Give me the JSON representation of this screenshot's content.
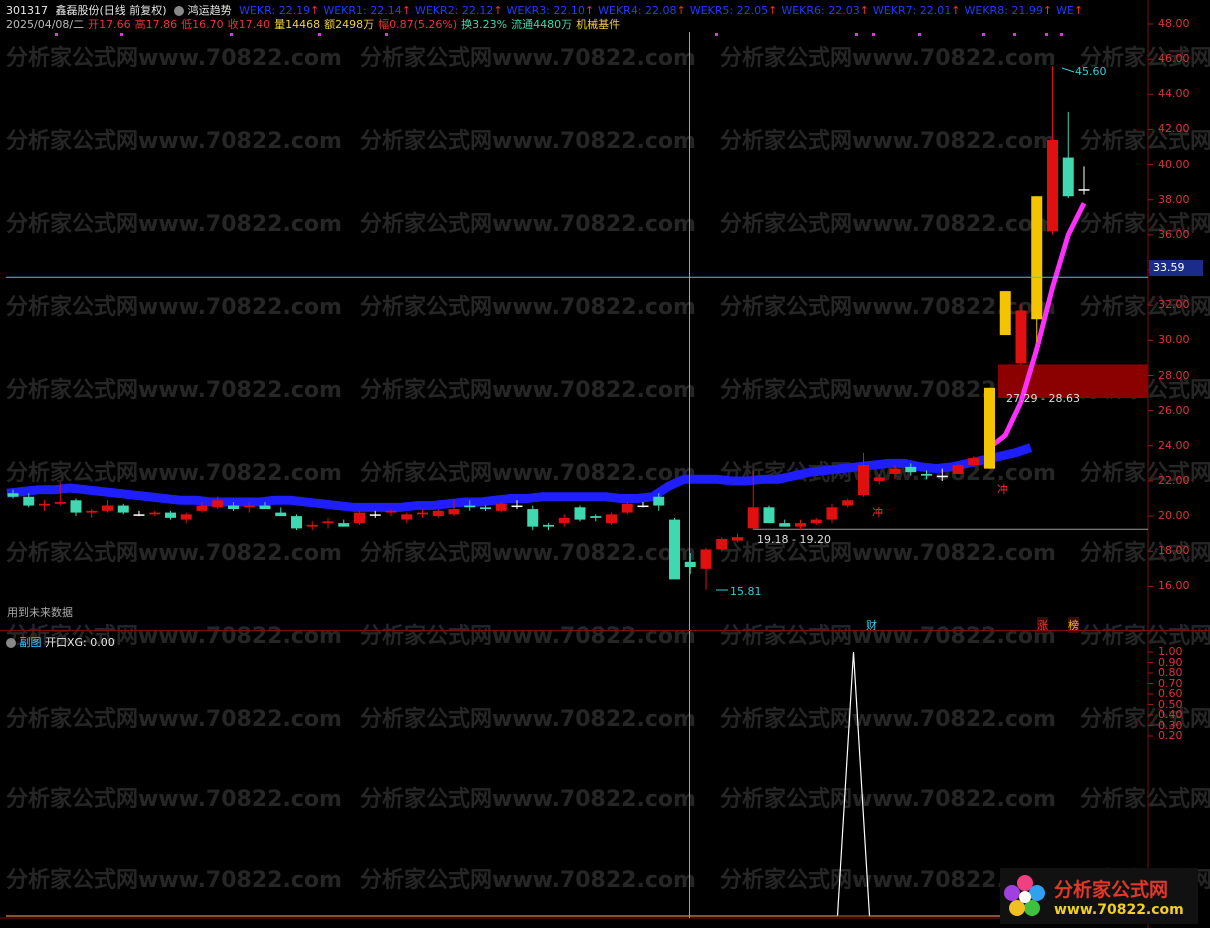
{
  "header": {
    "code": "301317",
    "name": "鑫磊股份(日线 前复权)",
    "indicator_name": "鸿运趋势",
    "wekr": [
      {
        "label": "WEKR: 22.19",
        "color": "#1e3cff"
      },
      {
        "label": "WEKR1: 22.14",
        "color": "#1e3cff"
      },
      {
        "label": "WEKR2: 22.12",
        "color": "#1e3cff"
      },
      {
        "label": "WEKR3: 22.10",
        "color": "#1e3cff"
      },
      {
        "label": "WEKR4: 22.08",
        "color": "#1e3cff"
      },
      {
        "label": "WEKR5: 22.05",
        "color": "#1e3cff"
      },
      {
        "label": "WEKR6: 22.03",
        "color": "#1e3cff"
      },
      {
        "label": "WEKR7: 22.01",
        "color": "#1e3cff"
      },
      {
        "label": "WEKR8: 21.99",
        "color": "#1e3cff"
      },
      {
        "label": "WE",
        "color": "#1e3cff"
      }
    ],
    "date": "2025/04/08/二",
    "open": "开17.66",
    "high": "高17.86",
    "low": "低16.70",
    "close": "收17.40",
    "volume": "量14468",
    "amount": "额2498万",
    "change": "幅0.87(5.26%)",
    "turnover": "换3.23%",
    "float": "流通4480万",
    "industry": "机械基件"
  },
  "main_chart": {
    "y_ticks": [
      "48.00",
      "46.00",
      "44.00",
      "42.00",
      "40.00",
      "38.00",
      "36.00",
      "34.00",
      "32.00",
      "30.00",
      "28.00",
      "26.00",
      "24.00",
      "22.00",
      "20.00",
      "18.00",
      "16.00"
    ],
    "y_values": [
      48,
      46,
      44,
      42,
      40,
      38,
      36,
      34,
      32,
      30,
      28,
      26,
      24,
      22,
      20,
      18,
      16
    ],
    "current_price": "33.59",
    "annotations": {
      "high_label": "45.60",
      "low_label": "15.81",
      "range1": "19.18 - 19.20",
      "range2": "27.29 - 28.63",
      "chong1": "冲",
      "chong2": "冲",
      "future_note": "用到未来数据",
      "tag_cai": "财",
      "tag_zhang": "涨",
      "tag_bang": "榜"
    },
    "colors": {
      "up": "#e01010",
      "down": "#40d8b0",
      "gold": "#f5c400",
      "trend_blue": "#1e1eff",
      "trend_magenta": "#ff30ff",
      "crosshair": "#40c8d8",
      "red_zone": "#8b0000"
    },
    "candles": [
      [
        21.3,
        21.5,
        21.0,
        21.1
      ],
      [
        21.1,
        21.3,
        20.5,
        20.6
      ],
      [
        20.6,
        20.9,
        20.3,
        20.7
      ],
      [
        20.7,
        21.9,
        20.6,
        20.8
      ],
      [
        20.9,
        21.0,
        20.0,
        20.2
      ],
      [
        20.2,
        20.4,
        19.9,
        20.3
      ],
      [
        20.3,
        20.9,
        20.2,
        20.6
      ],
      [
        20.6,
        20.7,
        20.1,
        20.2
      ],
      [
        20.1,
        20.3,
        20.0,
        20.1
      ],
      [
        20.1,
        20.3,
        20.0,
        20.2
      ],
      [
        20.2,
        20.3,
        19.8,
        19.9
      ],
      [
        19.8,
        20.2,
        19.6,
        20.1
      ],
      [
        20.3,
        20.8,
        20.2,
        20.6
      ],
      [
        20.5,
        21.1,
        20.4,
        20.9
      ],
      [
        20.6,
        20.8,
        20.3,
        20.4
      ],
      [
        20.5,
        20.8,
        20.2,
        20.6
      ],
      [
        20.6,
        20.8,
        20.4,
        20.4
      ],
      [
        20.2,
        20.5,
        20.0,
        20.0
      ],
      [
        20.0,
        20.1,
        19.2,
        19.3
      ],
      [
        19.4,
        19.7,
        19.2,
        19.5
      ],
      [
        19.6,
        19.9,
        19.3,
        19.7
      ],
      [
        19.6,
        19.8,
        19.4,
        19.4
      ],
      [
        19.6,
        20.3,
        19.5,
        20.2
      ],
      [
        20.1,
        20.3,
        19.9,
        20.1
      ],
      [
        20.2,
        20.4,
        20.0,
        20.3
      ],
      [
        19.8,
        20.2,
        19.6,
        20.1
      ],
      [
        20.1,
        20.4,
        19.9,
        20.2
      ],
      [
        20.0,
        20.4,
        19.9,
        20.3
      ],
      [
        20.1,
        20.9,
        20.0,
        20.4
      ],
      [
        20.6,
        20.9,
        20.3,
        20.5
      ],
      [
        20.5,
        20.6,
        20.3,
        20.4
      ],
      [
        20.3,
        20.8,
        20.2,
        20.7
      ],
      [
        20.6,
        20.9,
        20.4,
        20.6
      ],
      [
        20.4,
        20.6,
        19.2,
        19.4
      ],
      [
        19.5,
        19.6,
        19.2,
        19.4
      ],
      [
        19.6,
        20.1,
        19.4,
        19.9
      ],
      [
        20.5,
        20.6,
        19.7,
        19.8
      ],
      [
        20.0,
        20.1,
        19.7,
        19.9
      ],
      [
        19.6,
        20.2,
        19.5,
        20.1
      ],
      [
        20.2,
        20.8,
        20.1,
        20.7
      ],
      [
        20.6,
        20.8,
        20.5,
        20.6
      ],
      [
        21.1,
        21.3,
        20.3,
        20.6
      ],
      [
        19.8,
        19.9,
        16.4,
        16.4
      ],
      [
        17.4,
        17.9,
        16.7,
        17.1
      ],
      [
        17.0,
        18.2,
        15.8,
        18.1
      ],
      [
        18.1,
        18.8,
        18.0,
        18.7
      ],
      [
        18.6,
        19.0,
        18.5,
        18.8
      ],
      [
        19.3,
        22.6,
        19.2,
        20.5
      ],
      [
        20.5,
        20.6,
        19.6,
        19.6
      ],
      [
        19.6,
        19.8,
        19.4,
        19.4
      ],
      [
        19.4,
        19.8,
        19.2,
        19.6
      ],
      [
        19.6,
        19.9,
        19.5,
        19.8
      ],
      [
        19.8,
        20.7,
        19.6,
        20.5
      ],
      [
        20.6,
        21.0,
        20.5,
        20.9
      ],
      [
        21.2,
        23.6,
        21.1,
        22.9
      ],
      [
        22.0,
        22.4,
        21.8,
        22.2
      ],
      [
        22.4,
        22.9,
        22.1,
        22.7
      ],
      [
        22.8,
        23.0,
        22.3,
        22.5
      ],
      [
        22.4,
        22.6,
        22.1,
        22.3
      ],
      [
        22.3,
        22.7,
        22.0,
        22.3
      ],
      [
        22.4,
        23.0,
        22.4,
        22.9
      ],
      [
        22.9,
        23.4,
        22.8,
        23.3
      ],
      [
        22.7,
        27.3,
        22.7,
        27.3
      ],
      [
        30.3,
        32.8,
        30.3,
        32.8
      ],
      [
        28.7,
        32.1,
        28.6,
        31.7
      ],
      [
        31.2,
        38.2,
        29.9,
        38.2
      ],
      [
        36.2,
        45.6,
        36.0,
        41.4
      ],
      [
        40.4,
        43.0,
        38.1,
        38.2
      ],
      [
        38.6,
        39.9,
        38.3,
        38.6
      ]
    ],
    "gold_indices": [
      62,
      63,
      65
    ],
    "trend_blue": [
      21.3,
      21.4,
      21.5,
      21.5,
      21.6,
      21.5,
      21.4,
      21.3,
      21.2,
      21.1,
      21.0,
      20.9,
      20.9,
      20.8,
      20.8,
      20.8,
      20.8,
      20.9,
      20.9,
      20.8,
      20.7,
      20.6,
      20.5,
      20.5,
      20.5,
      20.5,
      20.6,
      20.6,
      20.7,
      20.8,
      20.8,
      20.9,
      21.0,
      21.0,
      21.1,
      21.1,
      21.1,
      21.1,
      21.1,
      21.0,
      21.0,
      21.1,
      21.7,
      22.1,
      22.1,
      22.1,
      22.0,
      22.0,
      22.1,
      22.1,
      22.3,
      22.5,
      22.6,
      22.7,
      22.8,
      22.9,
      23.0,
      23.0,
      22.8,
      22.7,
      22.8,
      23.0,
      23.2,
      23.4,
      23.6,
      23.9
    ],
    "trend_magenta": [
      [
        62,
        23.9
      ],
      [
        63,
        24.6
      ],
      [
        64,
        26.5
      ],
      [
        65,
        29.5
      ],
      [
        66,
        33.0
      ],
      [
        67,
        36.0
      ],
      [
        68,
        37.8
      ]
    ],
    "cross_index": 42,
    "cross_price": 33.59,
    "support_line": 19.25
  },
  "sub_chart": {
    "title_prefix": "副图",
    "indicator": "开口XG: 0.00",
    "y_ticks": [
      "1.00",
      "0.90",
      "0.80",
      "0.70",
      "0.60",
      "0.50",
      "0.40",
      "0.30",
      "0.20"
    ],
    "y_values": [
      1.0,
      0.9,
      0.8,
      0.7,
      0.6,
      0.5,
      0.4,
      0.3,
      0.2
    ],
    "spike": {
      "index": 54,
      "value": 1.0
    }
  },
  "watermark": "分析家公式网www.70822.com",
  "logo": {
    "title": "分析家公式网",
    "url": "www.70822.com"
  }
}
